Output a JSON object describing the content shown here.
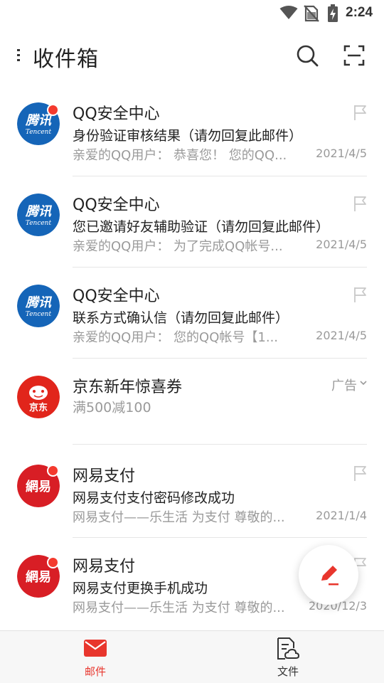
{
  "status_bar": {
    "time": "2:24"
  },
  "header": {
    "title": "收件箱"
  },
  "mails": [
    {
      "sender": "QQ安全中心",
      "subject": "身份验证审核结果（请勿回复此邮件）",
      "preview": "亲爱的QQ用户：  恭喜您！ 您的QQ...",
      "date": "2021/4/5",
      "unread": true,
      "avatar": "tencent-logo"
    },
    {
      "sender": "QQ安全中心",
      "subject": "您已邀请好友辅助验证（请勿回复此邮件）",
      "preview": "亲爱的QQ用户：  为了完成QQ帐号...",
      "date": "2021/4/5",
      "unread": false,
      "avatar": "tencent-logo"
    },
    {
      "sender": "QQ安全中心",
      "subject": "联系方式确认信（请勿回复此邮件）",
      "preview": "亲爱的QQ用户：  您的QQ帐号【1...",
      "date": "2021/4/5",
      "unread": false,
      "avatar": "tencent-logo"
    }
  ],
  "ad": {
    "sender": "京东新年惊喜券",
    "description": "满500减100",
    "tag": "广告",
    "avatar": "jd-logo"
  },
  "mails2": [
    {
      "sender": "网易支付",
      "subject": "网易支付支付密码修改成功",
      "preview": "网易支付——乐生活 为支付 尊敬的...",
      "date": "2021/1/4",
      "unread": true,
      "avatar": "netease-logo"
    },
    {
      "sender": "网易支付",
      "subject": "网易支付更换手机成功",
      "preview": "网易支付——乐生活 为支付 尊敬的...",
      "date": "2020/12/3",
      "unread": true,
      "avatar": "netease-logo"
    }
  ],
  "bottom_nav": {
    "mail_label": "邮件",
    "files_label": "文件"
  },
  "colors": {
    "accent": "#e8362d",
    "tencent_blue": "#1565b8",
    "unread_dot": "#f43a2e"
  },
  "logo_text": {
    "tencent_cn": "腾讯",
    "tencent_en": "Tencent",
    "jd": "京东",
    "netease": "網易"
  }
}
